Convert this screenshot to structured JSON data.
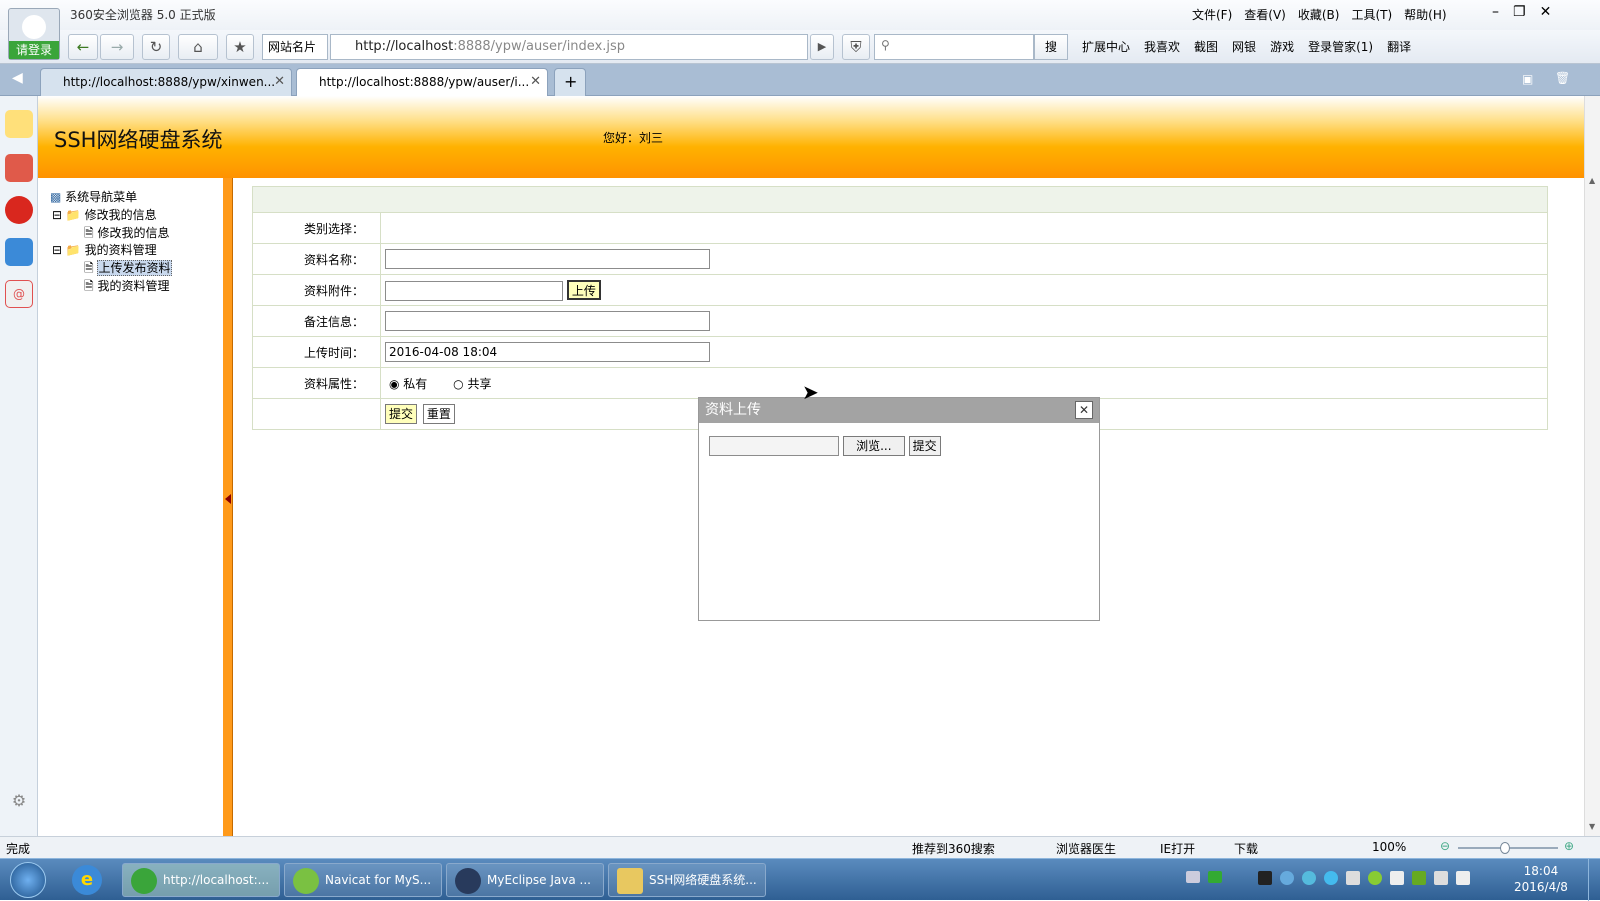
{
  "browser": {
    "app_title": "360安全浏览器 5.0 正式版",
    "login_label": "请登录",
    "menus": [
      "文件(F)",
      "查看(V)",
      "收藏(B)",
      "工具(T)",
      "帮助(H)"
    ],
    "site_card": "网站名片",
    "address_host": "http://localhost",
    "address_path": ":8888/ypw/auser/index.jsp",
    "search_button": "搜",
    "extensions": [
      "扩展中心",
      "我喜欢",
      "截图",
      "网银",
      "游戏",
      "登录管家(1)",
      "翻译"
    ],
    "tabs": [
      {
        "title": "http://localhost:8888/ypw/xinwen..."
      },
      {
        "title": "http://localhost:8888/ypw/auser/i..."
      }
    ]
  },
  "page": {
    "site_title": "SSH网络硬盘系统",
    "greeting": "您好：刘三",
    "tree": {
      "root": "系统导航菜单",
      "groups": [
        {
          "label": "修改我的信息",
          "items": [
            "修改我的信息"
          ]
        },
        {
          "label": "我的资料管理",
          "items": [
            "上传发布资料",
            "我的资料管理"
          ]
        }
      ]
    },
    "form": {
      "category_label": "类别选择：",
      "name_label": "资料名称：",
      "attachment_label": "资料附件：",
      "upload_button": "上传",
      "remark_label": "备注信息：",
      "time_label": "上传时间：",
      "time_value": "2016-04-08 18:04",
      "attribute_label": "资料属性：",
      "radio_private": "私有",
      "radio_shared": "共享",
      "submit_button": "提交",
      "reset_button": "重置"
    },
    "dialog": {
      "title": "资料上传",
      "browse_button": "浏览...",
      "submit_button": "提交"
    }
  },
  "statusbar": {
    "status": "完成",
    "recommend": "推荐到360搜索",
    "doctor": "浏览器医生",
    "ie_open": "IE打开",
    "download": "下载",
    "zoom": "100%"
  },
  "taskbar": {
    "tasks": [
      "http://localhost:...",
      "Navicat for MyS...",
      "MyEclipse Java ...",
      "SSH网络硬盘系统..."
    ],
    "time": "18:04",
    "date": "2016/4/8"
  },
  "colors": {
    "header_orange": "#ff9200",
    "divider": "#ff9a1a",
    "taskbar": "#2f5f93"
  }
}
